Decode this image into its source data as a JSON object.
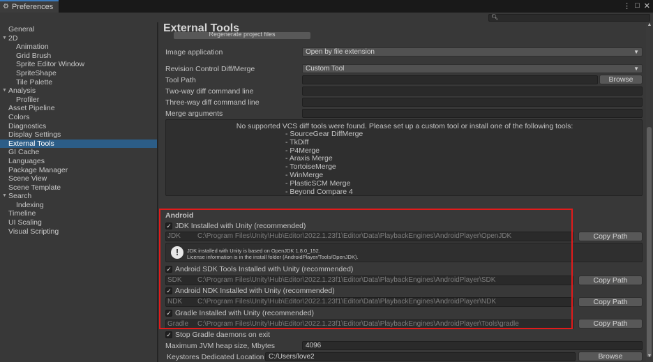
{
  "window": {
    "tab_title": "Preferences",
    "tab_icon": "gear-icon",
    "controls": [
      "⋮",
      "□",
      "✕"
    ]
  },
  "search": {
    "placeholder": ""
  },
  "sidebar": {
    "items": [
      {
        "label": "General",
        "level": 1,
        "fold": ""
      },
      {
        "label": "2D",
        "level": 1,
        "fold": "▼"
      },
      {
        "label": "Animation",
        "level": 2,
        "fold": ""
      },
      {
        "label": "Grid Brush",
        "level": 2,
        "fold": ""
      },
      {
        "label": "Sprite Editor Window",
        "level": 2,
        "fold": ""
      },
      {
        "label": "SpriteShape",
        "level": 2,
        "fold": ""
      },
      {
        "label": "Tile Palette",
        "level": 2,
        "fold": ""
      },
      {
        "label": "Analysis",
        "level": 1,
        "fold": "▼"
      },
      {
        "label": "Profiler",
        "level": 2,
        "fold": ""
      },
      {
        "label": "Asset Pipeline",
        "level": 1,
        "fold": ""
      },
      {
        "label": "Colors",
        "level": 1,
        "fold": ""
      },
      {
        "label": "Diagnostics",
        "level": 1,
        "fold": ""
      },
      {
        "label": "Display Settings",
        "level": 1,
        "fold": ""
      },
      {
        "label": "External Tools",
        "level": 1,
        "fold": "",
        "active": true
      },
      {
        "label": "GI Cache",
        "level": 1,
        "fold": ""
      },
      {
        "label": "Languages",
        "level": 1,
        "fold": ""
      },
      {
        "label": "Package Manager",
        "level": 1,
        "fold": ""
      },
      {
        "label": "Scene View",
        "level": 1,
        "fold": ""
      },
      {
        "label": "Scene Template",
        "level": 1,
        "fold": ""
      },
      {
        "label": "Search",
        "level": 1,
        "fold": "▼"
      },
      {
        "label": "Indexing",
        "level": 2,
        "fold": ""
      },
      {
        "label": "Timeline",
        "level": 1,
        "fold": ""
      },
      {
        "label": "UI Scaling",
        "level": 1,
        "fold": ""
      },
      {
        "label": "Visual Scripting",
        "level": 1,
        "fold": ""
      }
    ]
  },
  "main": {
    "title": "External Tools",
    "regenerate_label": "Regenerate project files",
    "image_application": {
      "label": "Image application",
      "value": "Open by file extension"
    },
    "revision_control": {
      "label": "Revision Control Diff/Merge",
      "value": "Custom Tool"
    },
    "tool_path": {
      "label": "Tool Path",
      "value": "",
      "button": "Browse"
    },
    "two_way": {
      "label": "Two-way diff command line",
      "value": ""
    },
    "three_way": {
      "label": "Three-way diff command line",
      "value": ""
    },
    "merge_args": {
      "label": "Merge arguments",
      "value": ""
    },
    "vcs": {
      "message": "No supported VCS diff tools were found. Please set up a custom tool or install one of the following tools:",
      "tools": [
        "- SourceGear DiffMerge",
        "- TkDiff",
        "- P4Merge",
        "- Araxis Merge",
        "- TortoiseMerge",
        "- WinMerge",
        "- PlasticSCM Merge",
        "- Beyond Compare 4"
      ]
    },
    "android": {
      "title": "Android",
      "jdk_check": "JDK Installed with Unity (recommended)",
      "jdk_label": "JDK",
      "jdk_path": "C:\\Program Files\\Unity\\Hub\\Editor\\2022.1.23f1\\Editor\\Data\\PlaybackEngines\\AndroidPlayer\\OpenJDK",
      "info_line1": "JDK installed with Unity is based on OpenJDK 1.8.0_152.",
      "info_line2": "License information is in the install folder (AndroidPlayer/Tools/OpenJDK).",
      "sdk_check": "Android SDK Tools Installed with Unity (recommended)",
      "sdk_label": "SDK",
      "sdk_path": "C:\\Program Files\\Unity\\Hub\\Editor\\2022.1.23f1\\Editor\\Data\\PlaybackEngines\\AndroidPlayer\\SDK",
      "ndk_check": "Android NDK Installed with Unity (recommended)",
      "ndk_label": "NDK",
      "ndk_path": "C:\\Program Files\\Unity\\Hub\\Editor\\2022.1.23f1\\Editor\\Data\\PlaybackEngines\\AndroidPlayer\\NDK",
      "gradle_check": "Gradle Installed with Unity (recommended)",
      "gradle_label": "Gradle",
      "gradle_path": "C:\\Program Files\\Unity\\Hub\\Editor\\2022.1.23f1\\Editor\\Data\\PlaybackEngines\\AndroidPlayer\\Tools\\gradle",
      "copy_path": "Copy Path",
      "stop_gradle": "Stop Gradle daemons on exit",
      "jvm_label": "Maximum JVM heap size, Mbytes",
      "jvm_value": "4096",
      "keystores_label": "Keystores Dedicated Location",
      "keystores_value": "C:/Users/love2",
      "browse": "Browse"
    }
  },
  "colors": {
    "accent": "#2c5d87",
    "highlight_box": "#e21b1b"
  }
}
